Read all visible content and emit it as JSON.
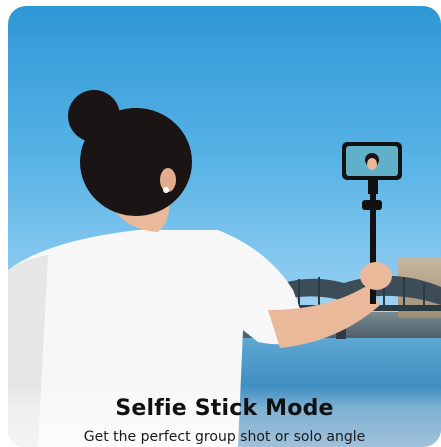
{
  "banner": {
    "title": "Selfie Stick Mode",
    "subtitle": "Get the perfect group shot or solo angle"
  },
  "colors": {
    "sky_top": "#2f97d6",
    "sky_bottom": "#d6eef9",
    "shirt": "#f7f7f7",
    "hair": "#1b1414",
    "stick": "#111111"
  },
  "image": {
    "subject": "woman holding selfie stick with phone",
    "background": "river with steel bridge and buildings under blue sky"
  }
}
